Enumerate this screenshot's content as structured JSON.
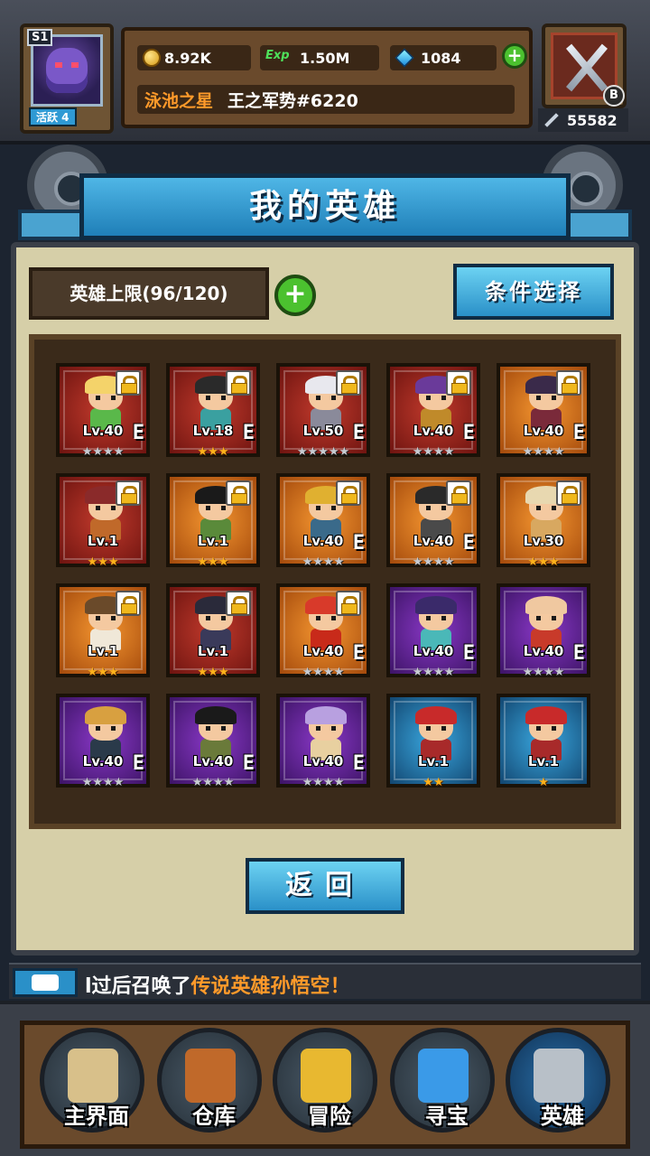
{
  "header": {
    "server_badge": "S1",
    "active_label": "活跃 4",
    "gold": "8.92K",
    "exp_icon": "Exp",
    "exp": "1.50M",
    "diamonds": "1084",
    "guild_name": "泳池之星",
    "player_name": "王之军势#6220",
    "weapon_badge": "B",
    "power": "55582"
  },
  "page": {
    "title": "我的英雄",
    "hero_limit": "英雄上限(96/120)",
    "filter_button": "条件选择",
    "back_button": "返回"
  },
  "heroes": [
    {
      "lv": "Lv.40",
      "e": "E",
      "stars": 4,
      "on": 0,
      "frame": "red",
      "hair": "#f4d36a",
      "body": "#5ab84a",
      "locked": true
    },
    {
      "lv": "Lv.18",
      "e": "E",
      "stars": 3,
      "on": 3,
      "frame": "red",
      "hair": "#2a2a2a",
      "body": "#3aa0a0",
      "locked": true
    },
    {
      "lv": "Lv.50",
      "e": "E",
      "stars": 5,
      "on": 0,
      "frame": "red",
      "hair": "#e8e8ee",
      "body": "#8a8a9a",
      "locked": true
    },
    {
      "lv": "Lv.40",
      "e": "E",
      "stars": 4,
      "on": 0,
      "frame": "red",
      "hair": "#6a3a9a",
      "body": "#c08a2a",
      "locked": true
    },
    {
      "lv": "Lv.40",
      "e": "E",
      "stars": 4,
      "on": 0,
      "frame": "orange",
      "hair": "#3a2a4a",
      "body": "#7a2a3a",
      "locked": true
    },
    {
      "lv": "Lv.1",
      "e": "",
      "stars": 3,
      "on": 3,
      "frame": "red",
      "hair": "#8a2a2a",
      "body": "#c0692a",
      "locked": true
    },
    {
      "lv": "Lv.1",
      "e": "",
      "stars": 3,
      "on": 3,
      "frame": "orange",
      "hair": "#1a1a1a",
      "body": "#5a8a3a",
      "locked": true
    },
    {
      "lv": "Lv.40",
      "e": "E",
      "stars": 4,
      "on": 0,
      "frame": "orange",
      "hair": "#e0b030",
      "body": "#3a6a8a",
      "locked": true
    },
    {
      "lv": "Lv.40",
      "e": "E",
      "stars": 4,
      "on": 0,
      "frame": "orange",
      "hair": "#2a2a2a",
      "body": "#4a4a4a",
      "locked": true
    },
    {
      "lv": "Lv.30",
      "e": "",
      "stars": 3,
      "on": 3,
      "frame": "orange",
      "hair": "#e8d8b0",
      "body": "#d8a860",
      "locked": true
    },
    {
      "lv": "Lv.1",
      "e": "",
      "stars": 3,
      "on": 3,
      "frame": "orange",
      "hair": "#6a4a2a",
      "body": "#f0e8d8",
      "locked": true
    },
    {
      "lv": "Lv.1",
      "e": "",
      "stars": 3,
      "on": 3,
      "frame": "red",
      "hair": "#2a2a3a",
      "body": "#3a3a5a",
      "locked": true
    },
    {
      "lv": "Lv.40",
      "e": "E",
      "stars": 4,
      "on": 0,
      "frame": "orange",
      "hair": "#d83a2a",
      "body": "#c82a1a",
      "locked": true
    },
    {
      "lv": "Lv.40",
      "e": "E",
      "stars": 4,
      "on": 0,
      "frame": "purple",
      "hair": "#3a2a6a",
      "body": "#4ab8b8",
      "locked": false
    },
    {
      "lv": "Lv.40",
      "e": "E",
      "stars": 4,
      "on": 0,
      "frame": "purple",
      "hair": "#f0c8a0",
      "body": "#c83a2a",
      "locked": false
    },
    {
      "lv": "Lv.40",
      "e": "E",
      "stars": 4,
      "on": 0,
      "frame": "purple",
      "hair": "#d8a040",
      "body": "#2a3a4a",
      "locked": false
    },
    {
      "lv": "Lv.40",
      "e": "E",
      "stars": 4,
      "on": 0,
      "frame": "purple",
      "hair": "#1a1a1a",
      "body": "#6a7a3a",
      "locked": false
    },
    {
      "lv": "Lv.40",
      "e": "E",
      "stars": 4,
      "on": 0,
      "frame": "purple",
      "hair": "#b8a0e0",
      "body": "#e8d0a0",
      "locked": false
    },
    {
      "lv": "Lv.1",
      "e": "",
      "stars": 2,
      "on": 2,
      "frame": "blue",
      "hair": "#c82a2a",
      "body": "#a82a2a",
      "locked": false
    },
    {
      "lv": "Lv.1",
      "e": "",
      "stars": 1,
      "on": 1,
      "frame": "blue",
      "hair": "#c82a2a",
      "body": "#a82a2a",
      "locked": false
    }
  ],
  "ticker": {
    "prefix": "l过后召唤了",
    "highlight": "传说英雄孙悟空",
    "suffix": "！"
  },
  "nav": [
    {
      "label": "主界面",
      "icon": "scroll-icon",
      "color": "#d8c08a"
    },
    {
      "label": "仓库",
      "icon": "chest-icon",
      "color": "#c0692a"
    },
    {
      "label": "冒险",
      "icon": "sword-icon",
      "color": "#e8b830"
    },
    {
      "label": "寻宝",
      "icon": "crystal-icon",
      "color": "#3a9ae8"
    },
    {
      "label": "英雄",
      "icon": "helmet-icon",
      "color": "#b8c0c8"
    }
  ]
}
